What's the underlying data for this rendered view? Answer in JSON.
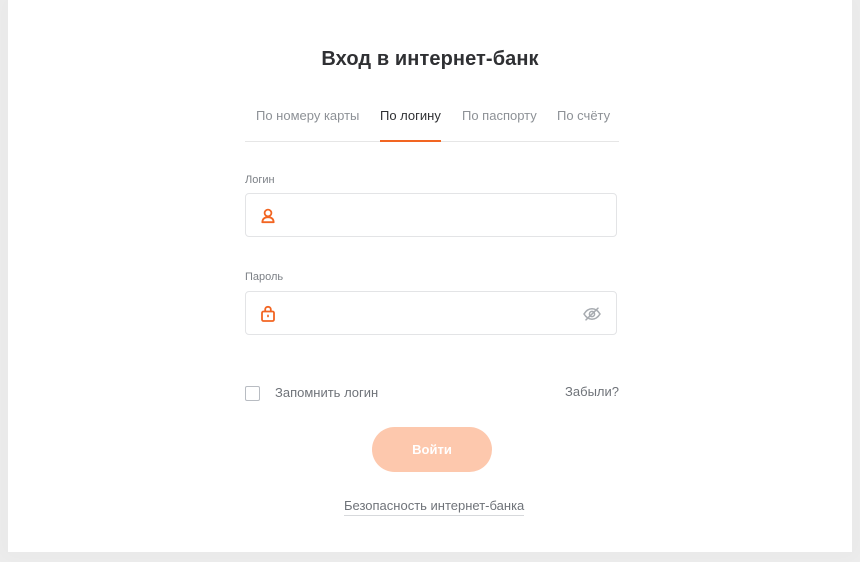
{
  "page": {
    "title": "Вход в интернет-банк"
  },
  "tabs": [
    {
      "label": "По номеру карты",
      "active": false
    },
    {
      "label": "По логину",
      "active": true
    },
    {
      "label": "По паспорту",
      "active": false
    },
    {
      "label": "По счёту",
      "active": false
    }
  ],
  "login_field": {
    "label": "Логин",
    "value": "",
    "icon": "user-icon"
  },
  "password_field": {
    "label": "Пароль",
    "value": "",
    "icon": "lock-icon",
    "toggle_icon": "eye-hidden-icon"
  },
  "remember": {
    "label": "Запомнить логин",
    "checked": false
  },
  "forgot_label": "Забыли?",
  "submit_label": "Войти",
  "security_link": "Безопасность интернет-банка",
  "colors": {
    "accent": "#f26522",
    "button_disabled": "#fdc8ad"
  }
}
